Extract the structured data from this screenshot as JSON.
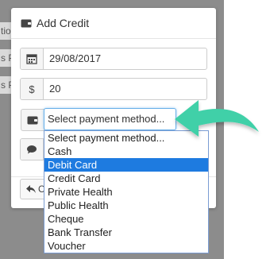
{
  "background": {
    "fragments": [
      "tio",
      "s P",
      "s P"
    ]
  },
  "modal": {
    "title": "Add Credit",
    "title_icon": "wallet-icon",
    "date": {
      "icon": "calendar-icon",
      "value": "29/08/2017"
    },
    "amount": {
      "icon": "dollar-sign",
      "symbol": "$",
      "value": "20"
    },
    "payment_method": {
      "icon": "wallet-icon",
      "selected": "Select payment method..."
    },
    "note": {
      "icon": "comment-icon"
    },
    "back_button": {
      "icon": "reply-icon",
      "label": "C"
    }
  },
  "dropdown": {
    "options": [
      "Select payment method...",
      "Cash",
      "Debit Card",
      "Credit Card",
      "Private Health",
      "Public Health",
      "Cheque",
      "Bank Transfer",
      "Voucher"
    ],
    "highlighted": "Debit Card"
  },
  "colors": {
    "highlight": "#1e7be0",
    "arrow": "#3fd0a8",
    "backdrop": "#8c8c8c"
  }
}
